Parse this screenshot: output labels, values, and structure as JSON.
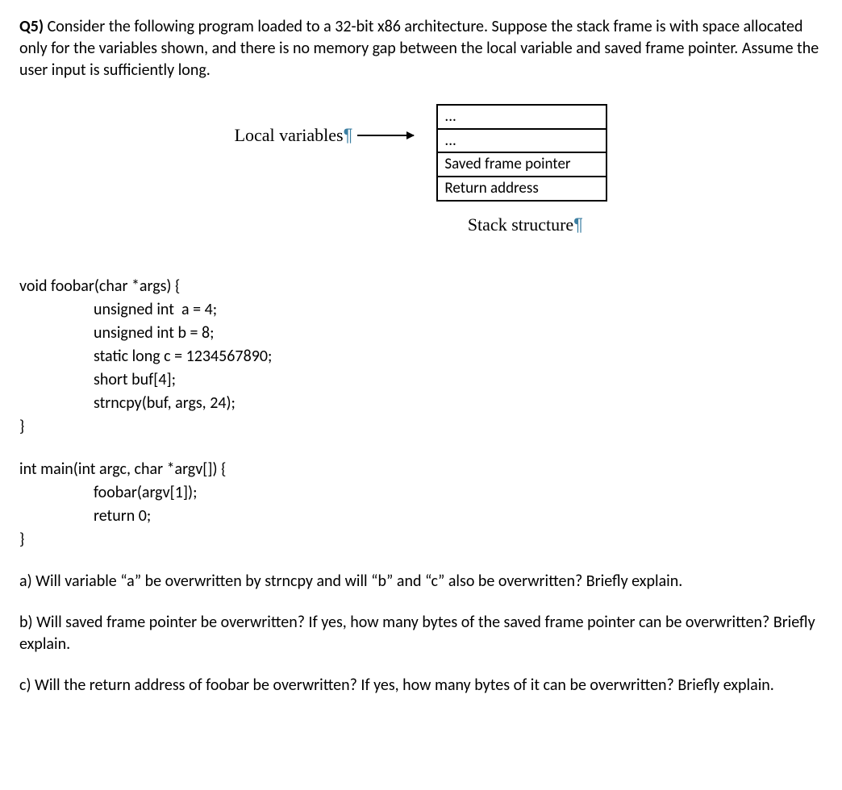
{
  "intro": {
    "label": "Q5)",
    "text": " Consider the following program loaded to a 32-bit x86 architecture. Suppose the stack frame is with space allocated only for the variables shown, and there is no memory gap between the local variable and saved frame pointer. Assume the user input is sufficiently long."
  },
  "diagram": {
    "local_vars_label": "Local variables",
    "stack_rows": {
      "r0": "...",
      "r1": "...",
      "r2": "Saved frame pointer",
      "r3": "Return address"
    },
    "caption": "Stack structure"
  },
  "code1": {
    "l0": "void foobar(char *args) {",
    "l1": "unsigned int  a = 4;",
    "l2": "unsigned int b = 8;",
    "l3": "static long c = 1234567890;",
    "l4": "short buf[4];",
    "l5": "strncpy(buf, args, 24);",
    "l6": "}"
  },
  "code2": {
    "l0": "int main(int argc, char *argv[]) {",
    "l1": "foobar(argv[1]);",
    "l2": "return 0;",
    "l3": "}"
  },
  "parts": {
    "a": "a) Will variable “a” be overwritten by strncpy and will “b” and “c” also be overwritten? Briefly explain.",
    "b": "b) Will saved frame pointer be overwritten? If yes, how many bytes of the saved frame pointer can be overwritten? Briefly explain.",
    "c": "c) Will the return address of foobar be overwritten? If yes, how many bytes of it can be overwritten? Briefly explain."
  }
}
